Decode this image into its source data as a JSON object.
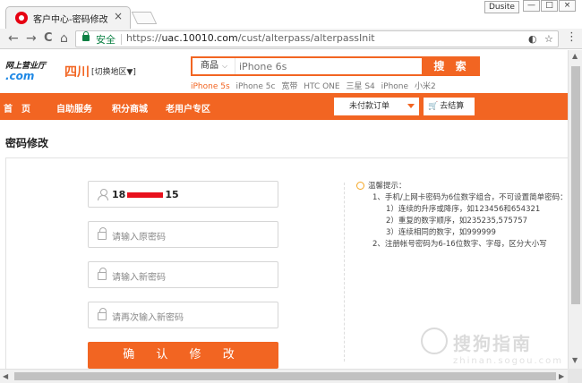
{
  "browser": {
    "tab_title": "客户中心-密码修改",
    "tab_close": "×",
    "user_badge": "Dusite",
    "window_controls": [
      "—",
      "□",
      "×"
    ],
    "nav": {
      "back": "←",
      "forward": "→",
      "reload": "C",
      "home": "⌂"
    },
    "secure_label": "安全",
    "url_scheme": "https://",
    "url_host": "uac.10010.com",
    "url_path": "/cust/alterpass/alterpassInit",
    "star": "☆",
    "menu": "⋮"
  },
  "header": {
    "logo_line1": "网上营业厅",
    "logo_line2": ".com",
    "region": "四川",
    "region_switch": "[切换地区▼]",
    "search": {
      "category": "商品",
      "placeholder": "iPhone 6s",
      "button": "搜 索"
    },
    "hot_keywords": [
      "iPhone 5s",
      "iPhone 5c",
      "宽带",
      "HTC ONE",
      "三星 S4",
      "iPhone",
      "小米2"
    ]
  },
  "navbar": {
    "items": [
      "首　页",
      "自助服务",
      "积分商城",
      "老用户专区"
    ],
    "order_select": "未付款订单",
    "checkout": "去结算"
  },
  "main": {
    "heading": "密码修改",
    "phone_prefix": "18",
    "phone_suffix": "15",
    "old_password_placeholder": "请输入原密码",
    "new_password_placeholder": "请输入新密码",
    "confirm_password_placeholder": "请再次输入新密码",
    "submit": "确 认 修 改"
  },
  "tips": {
    "title": "温馨提示：",
    "lines": [
      "1、手机/上网卡密码为6位数字组合，不可设置简单密码：",
      "1）连续的升序或降序，如123456和654321",
      "2）重复的数字顺序，如235235,575757",
      "3）连续相同的数字，如999999",
      "2、注册帐号密码为6-16位数字、字母，区分大小写"
    ]
  },
  "watermark": {
    "text": "搜狗指南",
    "sub": "zhinan.sogou.com"
  },
  "colors": {
    "brand_orange": "#f26522",
    "secure_green": "#0b8043",
    "redaction_red": "#e8111d"
  }
}
